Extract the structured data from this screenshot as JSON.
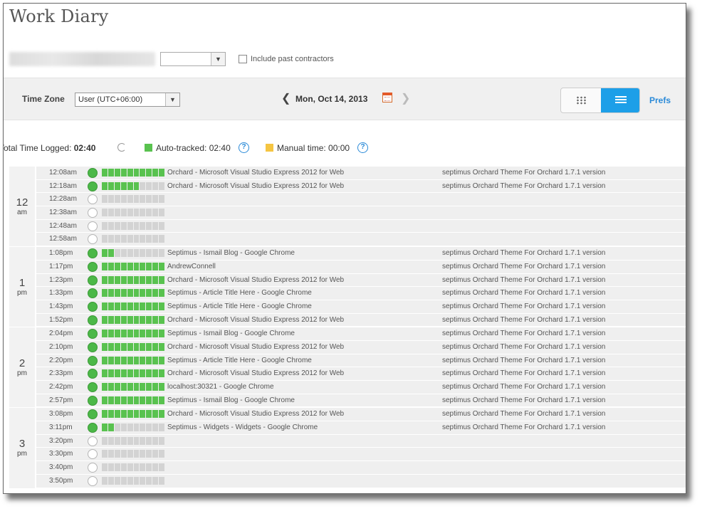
{
  "title": "Work Diary",
  "filter": {
    "include_past_label": "Include past contractors"
  },
  "toolbar": {
    "timezone_label": "Time Zone",
    "timezone_value": "User (UTC+06:00)",
    "date": "Mon, Oct 14, 2013",
    "prefs_label": "Prefs"
  },
  "summary": {
    "total_label": "Total Time Logged:",
    "total_value": "02:40",
    "auto_label": "Auto-tracked:",
    "auto_value": "02:40",
    "manual_label": "Manual time:",
    "manual_value": "00:00",
    "auto_color": "#59c24f",
    "manual_color": "#f5c542"
  },
  "hours": [
    {
      "hour": "12",
      "ampm": "am",
      "slots": [
        {
          "time": "12:08am",
          "active": true,
          "level": 10,
          "memo": "Orchard - Microsoft Visual Studio Express 2012 for Web",
          "task": "septimus Orchard Theme For Orchard 1.7.1 version"
        },
        {
          "time": "12:18am",
          "active": true,
          "level": 6,
          "memo": "Orchard - Microsoft Visual Studio Express 2012 for Web",
          "task": "septimus Orchard Theme For Orchard 1.7.1 version"
        },
        {
          "time": "12:28am",
          "active": false,
          "level": 0,
          "memo": "",
          "task": ""
        },
        {
          "time": "12:38am",
          "active": false,
          "level": 0,
          "memo": "",
          "task": ""
        },
        {
          "time": "12:48am",
          "active": false,
          "level": 0,
          "memo": "",
          "task": ""
        },
        {
          "time": "12:58am",
          "active": false,
          "level": 0,
          "memo": "",
          "task": ""
        }
      ]
    },
    {
      "hour": "1",
      "ampm": "pm",
      "slots": [
        {
          "time": "1:08pm",
          "active": true,
          "level": 2,
          "memo": "Septimus - Ismail Blog - Google Chrome",
          "task": "septimus Orchard Theme For Orchard 1.7.1 version"
        },
        {
          "time": "1:17pm",
          "active": true,
          "level": 10,
          "memo": "AndrewConnell",
          "task": "septimus Orchard Theme For Orchard 1.7.1 version"
        },
        {
          "time": "1:23pm",
          "active": true,
          "level": 10,
          "memo": "Orchard - Microsoft Visual Studio Express 2012 for Web",
          "task": "septimus Orchard Theme For Orchard 1.7.1 version"
        },
        {
          "time": "1:33pm",
          "active": true,
          "level": 10,
          "memo": "Septimus - Article Title Here - Google Chrome",
          "task": "septimus Orchard Theme For Orchard 1.7.1 version"
        },
        {
          "time": "1:43pm",
          "active": true,
          "level": 10,
          "memo": "Septimus - Article Title Here - Google Chrome",
          "task": "septimus Orchard Theme For Orchard 1.7.1 version"
        },
        {
          "time": "1:52pm",
          "active": true,
          "level": 10,
          "memo": "Orchard - Microsoft Visual Studio Express 2012 for Web",
          "task": "septimus Orchard Theme For Orchard 1.7.1 version"
        }
      ]
    },
    {
      "hour": "2",
      "ampm": "pm",
      "slots": [
        {
          "time": "2:04pm",
          "active": true,
          "level": 10,
          "memo": "Septimus - Ismail Blog - Google Chrome",
          "task": "septimus Orchard Theme For Orchard 1.7.1 version"
        },
        {
          "time": "2:10pm",
          "active": true,
          "level": 10,
          "memo": "Orchard - Microsoft Visual Studio Express 2012 for Web",
          "task": "septimus Orchard Theme For Orchard 1.7.1 version"
        },
        {
          "time": "2:20pm",
          "active": true,
          "level": 10,
          "memo": "Septimus - Article Title Here - Google Chrome",
          "task": "septimus Orchard Theme For Orchard 1.7.1 version"
        },
        {
          "time": "2:33pm",
          "active": true,
          "level": 10,
          "memo": "Orchard - Microsoft Visual Studio Express 2012 for Web",
          "task": "septimus Orchard Theme For Orchard 1.7.1 version"
        },
        {
          "time": "2:42pm",
          "active": true,
          "level": 10,
          "memo": "localhost:30321 - Google Chrome",
          "task": "septimus Orchard Theme For Orchard 1.7.1 version"
        },
        {
          "time": "2:57pm",
          "active": true,
          "level": 10,
          "memo": "Septimus - Ismail Blog - Google Chrome",
          "task": "septimus Orchard Theme For Orchard 1.7.1 version"
        }
      ]
    },
    {
      "hour": "3",
      "ampm": "pm",
      "slots": [
        {
          "time": "3:08pm",
          "active": true,
          "level": 10,
          "memo": "Orchard - Microsoft Visual Studio Express 2012 for Web",
          "task": "septimus Orchard Theme For Orchard 1.7.1 version"
        },
        {
          "time": "3:11pm",
          "active": true,
          "level": 2,
          "memo": "Septimus - Widgets - Widgets - Google Chrome",
          "task": "septimus Orchard Theme For Orchard 1.7.1 version"
        },
        {
          "time": "3:20pm",
          "active": false,
          "level": 0,
          "memo": "",
          "task": ""
        },
        {
          "time": "3:30pm",
          "active": false,
          "level": 0,
          "memo": "",
          "task": ""
        },
        {
          "time": "3:40pm",
          "active": false,
          "level": 0,
          "memo": "",
          "task": ""
        },
        {
          "time": "3:50pm",
          "active": false,
          "level": 0,
          "memo": "",
          "task": ""
        }
      ]
    }
  ]
}
